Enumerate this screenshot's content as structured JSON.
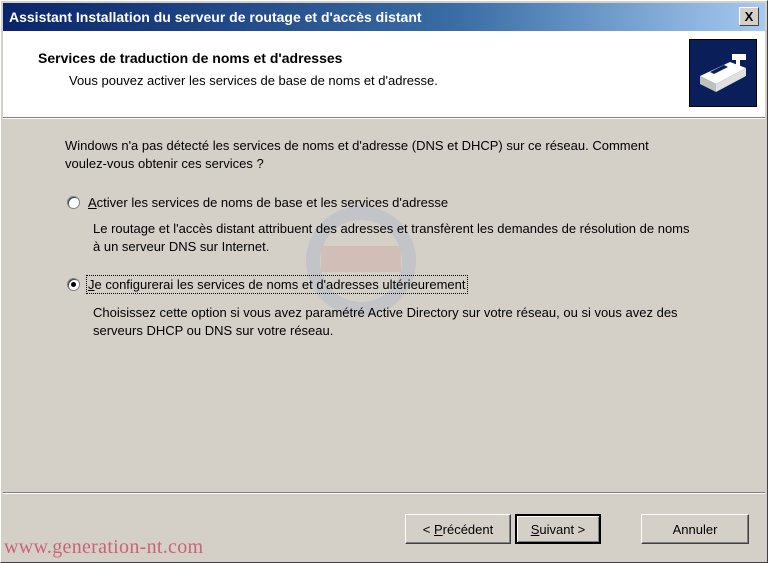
{
  "window": {
    "title": "Assistant Installation du serveur de routage et d'accès distant",
    "close_label": "X"
  },
  "header": {
    "title": "Services de traduction de noms et d'adresses",
    "subtitle": "Vous pouvez activer les services de base de noms et d'adresse.",
    "icon": "wizard-icon"
  },
  "content": {
    "intro": "Windows n'a pas détecté les services de noms et d'adresse (DNS et DHCP) sur ce réseau. Comment voulez-vous obtenir ces services ?",
    "options": [
      {
        "accel": "A",
        "label_rest": "ctiver les services de noms de base et les services d'adresse",
        "selected": false,
        "description": "Le routage et l'accès distant attribuent des adresses et transfèrent les demandes de résolution de noms à un serveur DNS sur Internet."
      },
      {
        "accel": "J",
        "label_rest": "e configurerai les services de noms et d'adresses ultérieurement",
        "selected": true,
        "description": "Choisissez cette option si vous avez paramétré Active Directory sur votre réseau, ou si vous avez des serveurs DHCP ou DNS sur votre réseau."
      }
    ]
  },
  "buttons": {
    "back_prefix": "< ",
    "back_accel": "P",
    "back_rest": "récédent",
    "next_accel": "S",
    "next_rest": "uivant >",
    "cancel": "Annuler"
  },
  "watermark": "www.generation-nt.com"
}
